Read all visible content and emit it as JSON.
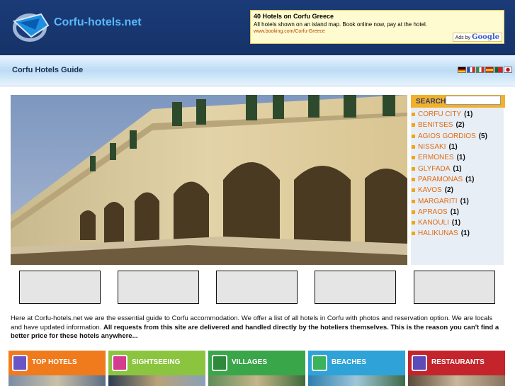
{
  "header": {
    "logo_text": "Corfu-hotels.net",
    "ad": {
      "title": "40 Hotels on Corfu Greece",
      "text": "All hotels shown on an island map. Book online now, pay at the hotel.",
      "url": "www.booking.com/Corfu-Greece",
      "ads_by": "Ads by",
      "ads_brand": "Google"
    }
  },
  "subbar": {
    "title": "Corfu Hotels Guide",
    "flags": [
      "german-flag",
      "french-flag",
      "italian-flag",
      "spanish-flag",
      "portuguese-flag",
      "japanese-flag"
    ]
  },
  "sidebar": {
    "search_label": "SEARCH",
    "search_value": "",
    "locations": [
      {
        "name": "CORFU CITY",
        "count": "(1)"
      },
      {
        "name": "BENITSES",
        "count": "(2)"
      },
      {
        "name": "AGIOS GORDIOS",
        "count": "(5)"
      },
      {
        "name": "NISSAKI",
        "count": "(1)"
      },
      {
        "name": "ERMONES",
        "count": "(1)"
      },
      {
        "name": "GLYFADA",
        "count": "(1)"
      },
      {
        "name": "PARAMONAS",
        "count": "(1)"
      },
      {
        "name": "KAVOS",
        "count": "(2)"
      },
      {
        "name": "MARGARITI",
        "count": "(1)"
      },
      {
        "name": "APRAOS",
        "count": "(1)"
      },
      {
        "name": "KANOULI",
        "count": "(1)"
      },
      {
        "name": "HALIKUNAS",
        "count": "(1)"
      }
    ]
  },
  "intro": {
    "text": "Here at Corfu-hotels.net we are the essential guide to Corfu accommodation. We offer a list of all hotels in Corfu with photos and reservation option. We are locals and have updated information. ",
    "bold": "All requests from this site are delivered and handled directly by the hoteliers themselves. This is the reason you can't find a better price for these hotels anywhere..."
  },
  "categories": [
    {
      "label": "TOP HOTELS",
      "color": "#f07b1d",
      "icon": "hotel-icon"
    },
    {
      "label": "SIGHTSEEING",
      "color": "#8bc53f",
      "icon": "camera-icon"
    },
    {
      "label": "VILLAGES",
      "color": "#3aa64a",
      "icon": "village-icon"
    },
    {
      "label": "BEACHES",
      "color": "#2fa3d8",
      "icon": "beach-icon"
    },
    {
      "label": "RESTAURANTS",
      "color": "#c4242c",
      "icon": "restaurant-icon"
    }
  ]
}
